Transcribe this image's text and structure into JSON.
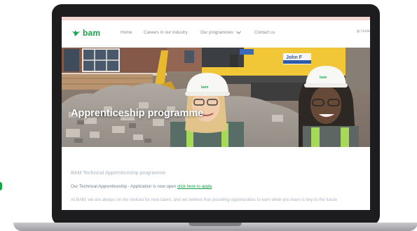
{
  "brand": {
    "logo_text": "bam",
    "color": "#17a34a"
  },
  "nav": {
    "items": [
      {
        "label": "Home"
      },
      {
        "label": "Careers in our industry"
      },
      {
        "label": "Our programmes"
      },
      {
        "label": "Contact us"
      }
    ],
    "utility": "Unite"
  },
  "hero": {
    "title": "Apprenticeship programme",
    "helmet_label": "bam",
    "sign_text": "John F"
  },
  "content": {
    "section_title": "BAM Technical Apprenticeship programme",
    "application_text": "Our Technical Apprenticeship - Application is now open",
    "apply_link": "click here to apply",
    "apply_suffix": ".",
    "intro_text": "At BAM, we are always on the lookout for new talent, and we believe that providing opportunities to earn while you learn is key to the future"
  }
}
